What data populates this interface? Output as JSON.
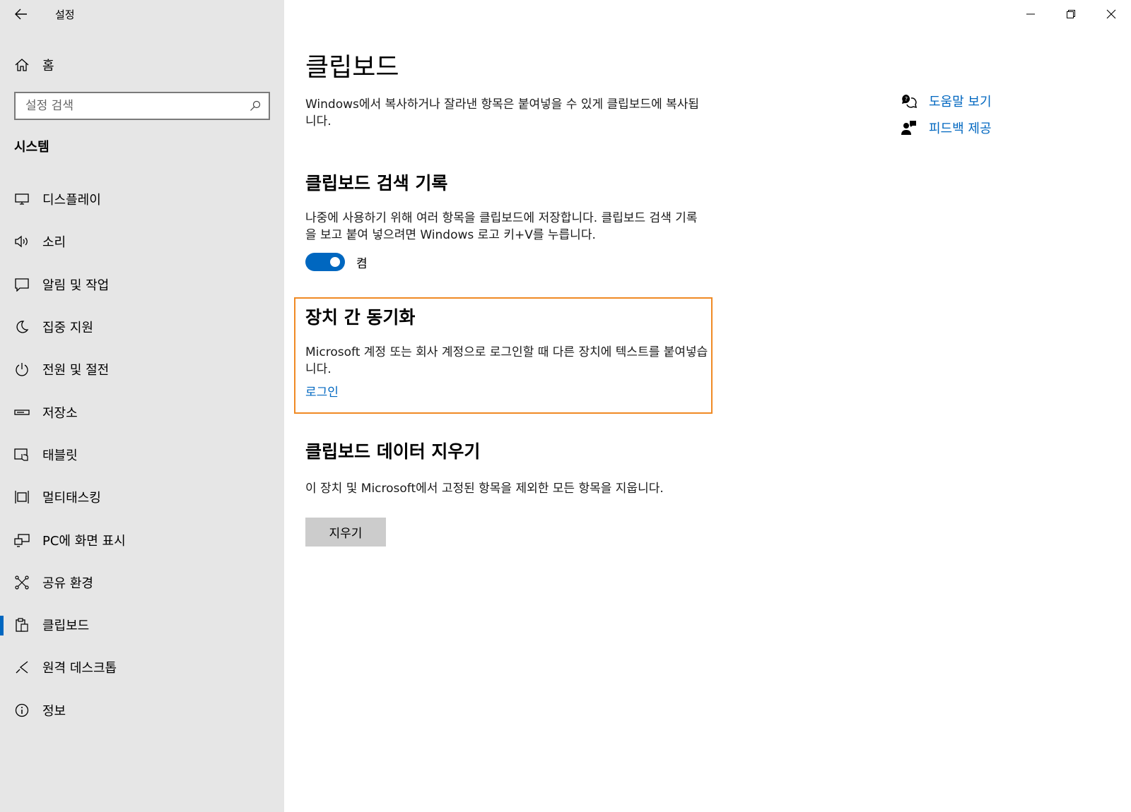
{
  "app": {
    "title": "설정"
  },
  "window_controls": {
    "minimize": "minimize-icon",
    "restore": "restore-icon",
    "close": "close-icon"
  },
  "sidebar": {
    "home_label": "홈",
    "search_placeholder": "설정 검색",
    "section_title": "시스템",
    "items": [
      {
        "label": "디스플레이",
        "icon": "display-icon"
      },
      {
        "label": "소리",
        "icon": "speaker-icon"
      },
      {
        "label": "알림 및 작업",
        "icon": "notification-icon"
      },
      {
        "label": "집중 지원",
        "icon": "moon-icon"
      },
      {
        "label": "전원 및 절전",
        "icon": "power-icon"
      },
      {
        "label": "저장소",
        "icon": "storage-icon"
      },
      {
        "label": "태블릿",
        "icon": "tablet-icon"
      },
      {
        "label": "멀티태스킹",
        "icon": "multitasking-icon"
      },
      {
        "label": "PC에 화면 표시",
        "icon": "project-icon"
      },
      {
        "label": "공유 환경",
        "icon": "share-icon"
      },
      {
        "label": "클립보드",
        "icon": "clipboard-icon",
        "active": true
      },
      {
        "label": "원격 데스크톱",
        "icon": "remote-desktop-icon"
      },
      {
        "label": "정보",
        "icon": "info-icon"
      }
    ]
  },
  "main": {
    "title": "클립보드",
    "intro": "Windows에서 복사하거나 잘라낸 항목은 붙여넣을 수 있게 클립보드에 복사됩니다.",
    "history": {
      "heading": "클립보드 검색 기록",
      "description": "나중에 사용하기 위해 여러 항목을 클립보드에 저장합니다. 클립보드 검색 기록을 보고 붙여 넣으려면 Windows 로고 키+V를 누릅니다.",
      "toggle_label": "켬",
      "toggle_on": true
    },
    "sync": {
      "heading": "장치 간 동기화",
      "description": "Microsoft 계정 또는 회사 계정으로 로그인할 때 다른 장치에 텍스트를 붙여넣습니다.",
      "link": "로그인"
    },
    "clear": {
      "heading": "클립보드 데이터 지우기",
      "description": "이 장치 및 Microsoft에서 고정된 항목을 제외한 모든 항목을 지웁니다.",
      "button": "지우기"
    }
  },
  "related": {
    "help": "도움말 보기",
    "feedback": "피드백 제공"
  },
  "colors": {
    "accent": "#0067c0",
    "highlight": "#f08a24",
    "sidebar_bg": "#e6e6e6"
  }
}
